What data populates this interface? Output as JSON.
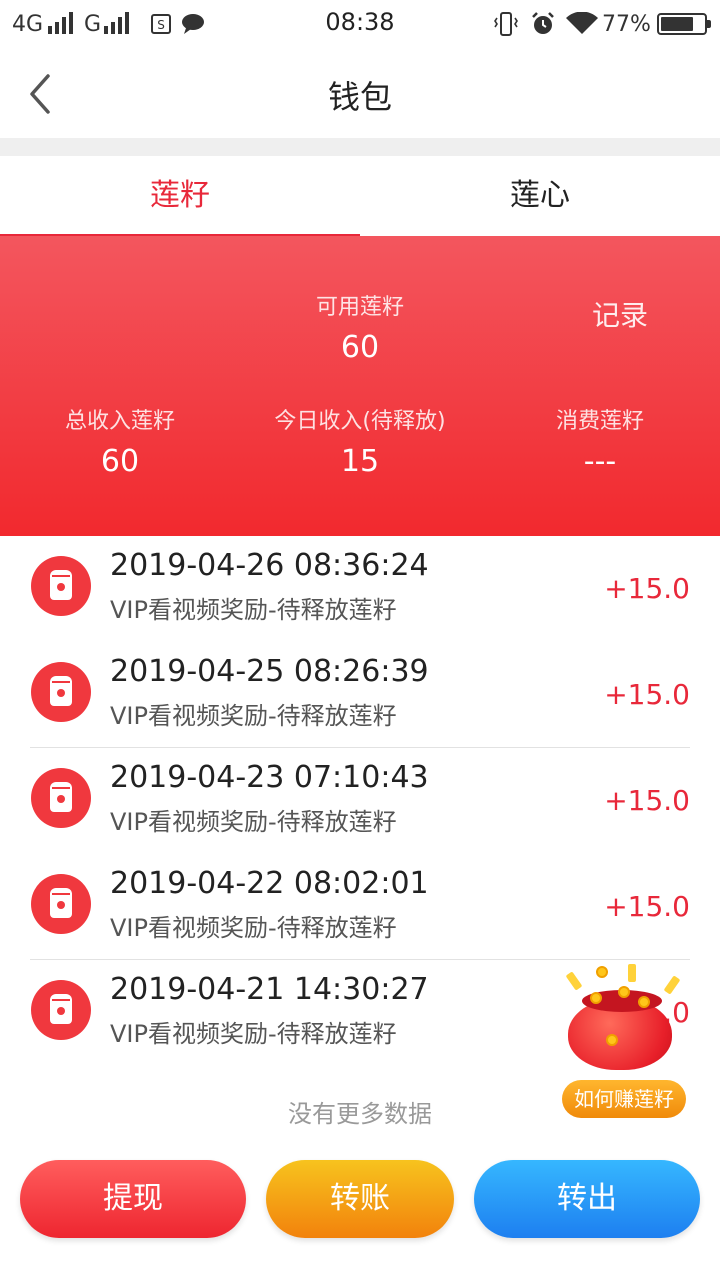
{
  "status_bar": {
    "network1": "4G",
    "network2": "G",
    "time": "08:38",
    "battery": "77%",
    "battery_level": 0.77
  },
  "header": {
    "title": "钱包"
  },
  "tabs": [
    {
      "label": "莲籽",
      "active": true
    },
    {
      "label": "莲心",
      "active": false
    }
  ],
  "summary": {
    "available_label": "可用莲籽",
    "available_value": "60",
    "record_label": "记录",
    "total_income_label": "总收入莲籽",
    "total_income_value": "60",
    "today_income_label": "今日收入(待释放)",
    "today_income_value": "15",
    "consumed_label": "消费莲籽",
    "consumed_value": "---"
  },
  "transactions": [
    {
      "date": "2019-04-26 08:36:24",
      "desc": "VIP看视频奖励-待释放莲籽",
      "amount": "+15.0"
    },
    {
      "date": "2019-04-25 08:26:39",
      "desc": "VIP看视频奖励-待释放莲籽",
      "amount": "+15.0"
    },
    {
      "date": "2019-04-23 07:10:43",
      "desc": "VIP看视频奖励-待释放莲籽",
      "amount": "+15.0"
    },
    {
      "date": "2019-04-22 08:02:01",
      "desc": "VIP看视频奖励-待释放莲籽",
      "amount": "+15.0"
    },
    {
      "date": "2019-04-21 14:30:27",
      "desc": "VIP看视频奖励-待释放莲籽",
      "amount": "+15.0"
    }
  ],
  "no_more_text": "没有更多数据",
  "promo": {
    "label": "如何赚莲籽"
  },
  "buttons": {
    "withdraw": "提现",
    "transfer": "转账",
    "transfer_out": "转出"
  },
  "colors": {
    "accent": "#e8283a",
    "summary_top": "#f3565e",
    "summary_bottom": "#f2292e",
    "withdraw": "#ee2630",
    "transfer": "#f2820c",
    "transfer_out": "#1d7ff0"
  }
}
